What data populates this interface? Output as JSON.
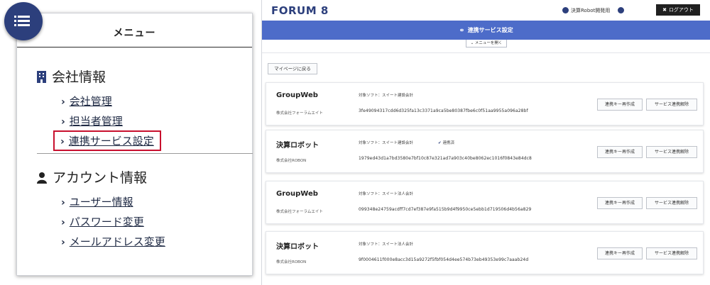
{
  "menu": {
    "title": "メニュー",
    "sections": [
      {
        "heading": "会社情報",
        "icon": "building-icon",
        "links": [
          "会社管理",
          "担当者管理",
          "連携サービス設定"
        ],
        "active_index": 2
      },
      {
        "heading": "アカウント情報",
        "icon": "user-icon",
        "links": [
          "ユーザー情報",
          "パスワード変更",
          "メールアドレス変更"
        ]
      }
    ]
  },
  "header": {
    "brand": "FORUM 8",
    "user_label": "決算Robot開発用",
    "logout_label": "ログアウト"
  },
  "page": {
    "title": "連携サービス設定",
    "menu_open_label": "メニューを開く",
    "back_label": "マイページに戻る"
  },
  "cards": [
    {
      "name": "GroupWeb",
      "company": "株式会社フォーラムエイト",
      "software": "対象ソフト：スイート建設会計",
      "status": "",
      "key": "3fe49094317cdd6d325fa13c3371a9ca5be80387fbe6c0f51aa9955a096a28bf",
      "regen_label": "連携キー再作成",
      "unlink_label": "サービス連携解除"
    },
    {
      "name": "決算ロボット",
      "company": "株式会社ROBON",
      "software": "対象ソフト：スイート建設会計",
      "status": "連携済",
      "key": "1979ed43d1a7bd3580e7bf10c87e321ad7a903c40be8062ec1016f0843e84dc8",
      "regen_label": "連携キー再作成",
      "unlink_label": "サービス連携解除"
    },
    {
      "name": "GroupWeb",
      "company": "株式会社フォーラムエイト",
      "software": "対象ソフト：スイート法人会計",
      "status": "",
      "key": "099348e24759acdff7cd7ef387e9fa515b9d4f9950ce5ebb1d719506d4b56a829",
      "regen_label": "連携キー再作成",
      "unlink_label": "サービス連携解除"
    },
    {
      "name": "決算ロボット",
      "company": "株式会社ROBON",
      "software": "対象ソフト：スイート法人会計",
      "status": "",
      "key": "9f0004611f000e8acc3d15a9272f5fbf054d4ee574b73eb49353e99c7aaab24d",
      "regen_label": "連携キー再作成",
      "unlink_label": "サービス連携解除"
    }
  ],
  "colors": {
    "brand": "#2c3f7c",
    "page_bar": "#4d6cc9",
    "active_outline": "#c8102e",
    "logout_bg": "#202020"
  }
}
